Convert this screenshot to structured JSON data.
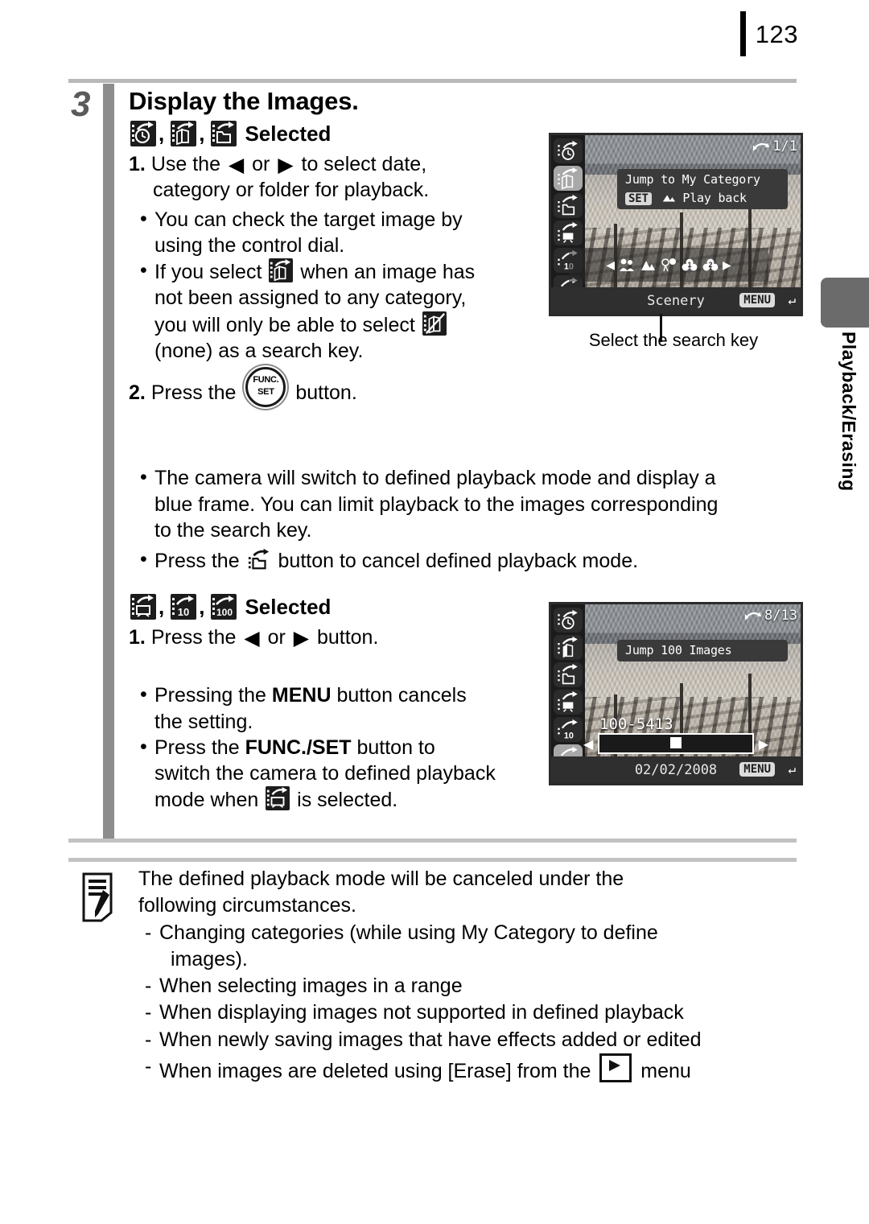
{
  "page": {
    "number": "123",
    "section_tab": "Playback/Erasing"
  },
  "step": {
    "number": "3",
    "title": "Display the Images."
  },
  "section_one": {
    "heading_label": "Selected",
    "icons": [
      "jump-date-icon",
      "jump-category-icon",
      "jump-folder-icon"
    ],
    "items": [
      {
        "num": "1.",
        "line1_a": "Use the",
        "arrow_left": "◀",
        "or": "or",
        "arrow_right": "▶",
        "line1_b": "to select date,",
        "line2": "category or folder for playback."
      }
    ],
    "bullets": [
      {
        "line1": "You can check the target image by",
        "line2": "using the control dial."
      },
      {
        "pre": "If you select",
        "icon": "jump-category-icon",
        "mid": "when an image has",
        "line2": "not been assigned to any category,",
        "line3_a": "you will only be able to select",
        "icon2": "no-category-icon",
        "line4": "(none) as a search key."
      }
    ],
    "step2": {
      "num": "2.",
      "pre": "Press the",
      "button": "FUNC./SET",
      "button_top": "FUNC.",
      "button_bottom": "SET",
      "post": "button."
    }
  },
  "wide_bullets": [
    {
      "line1": "The camera will switch to defined playback mode and display a",
      "line2": "blue frame. You can limit playback to the images corresponding",
      "line3": "to the search key."
    },
    {
      "pre": "Press the",
      "icon": "jump-folder-icon",
      "post": "button to cancel defined playback mode."
    }
  ],
  "section_two": {
    "heading_label": "Selected",
    "icons": [
      "jump-movie-icon",
      "jump-10-icon",
      "jump-100-icon"
    ],
    "item1": {
      "num": "1.",
      "pre": "Press the",
      "arrow_left": "◀",
      "or": "or",
      "arrow_right": "▶",
      "post": "button."
    },
    "bullets": [
      {
        "pre": "Pressing the",
        "bold": "MENU",
        "post": "button cancels",
        "line2": "the setting."
      },
      {
        "pre": "Press the",
        "bold": "FUNC./SET",
        "post": "button to",
        "line2": "switch the camera to defined playback",
        "line3_a": "mode when",
        "icon": "jump-movie-icon",
        "line3_b": "is selected."
      }
    ]
  },
  "lcd_top": {
    "counter": "1/1",
    "rotate_icon": "rotate-icon",
    "tip_line1": "Jump to My Category",
    "set_label": "SET",
    "tip_line2": "Play back",
    "tip_icon": "scenery-icon",
    "bottom_label": "Scenery",
    "menu_label": "MENU",
    "return_icon": "return-icon",
    "sidebar_icons": [
      "jump-date-icon",
      "jump-category-icon",
      "jump-folder-icon",
      "jump-movie-icon",
      "jump-10-icon",
      "jump-100-icon"
    ],
    "selected_sidebar_index": 1,
    "categories": [
      "people-icon",
      "scenery-icon",
      "events-icon",
      "category-1-icon",
      "category-2-icon"
    ],
    "caption": "Select the search key"
  },
  "lcd_bottom": {
    "counter": "8/13",
    "rotate_icon": "rotate-icon",
    "tip_line1": "Jump 100 Images",
    "file_number": "100-5413",
    "date": "02/02/2008",
    "menu_label": "MENU",
    "return_icon": "return-icon",
    "sidebar_icons": [
      "jump-date-icon",
      "jump-category-icon",
      "jump-folder-icon",
      "jump-movie-icon",
      "jump-10-icon",
      "jump-100-icon"
    ],
    "selected_sidebar_index": 5
  },
  "note": {
    "icon": "note-pencil-icon",
    "intro_line1": "The defined playback mode will be canceled under the",
    "intro_line2": "following circumstances.",
    "items": [
      {
        "line1": "Changing categories (while using My Category to define",
        "line2": "images)."
      },
      {
        "line1": "When selecting images in a range"
      },
      {
        "line1": "When displaying images not supported in defined playback"
      },
      {
        "line1": "When newly saving images that have effects added or edited"
      },
      {
        "pre": "When images are deleted using [Erase] from the",
        "icon": "playback-menu-icon",
        "post": "menu"
      }
    ]
  },
  "colors": {
    "step_bar": "#8d8d8d",
    "rule": "#c2c2c2",
    "tab": "#6b6b6b",
    "lcd_frame": "#2b2b2b"
  }
}
